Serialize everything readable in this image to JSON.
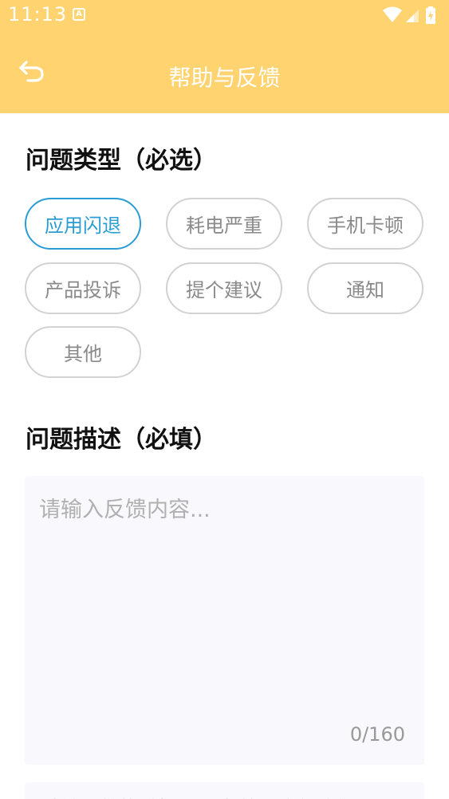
{
  "status_bar": {
    "time": "11:13",
    "notification_glyph": "A",
    "icons": [
      "wifi-icon",
      "cell-signal-icon",
      "battery-icon"
    ]
  },
  "app_bar": {
    "title": "帮助与反馈",
    "back_icon": "back-arrow-icon",
    "background": "#ffd36f"
  },
  "problem_type": {
    "title": "问题类型（必选）",
    "options": [
      {
        "label": "应用闪退",
        "selected": true
      },
      {
        "label": "耗电严重",
        "selected": false
      },
      {
        "label": "手机卡顿",
        "selected": false
      },
      {
        "label": "产品投诉",
        "selected": false
      },
      {
        "label": "提个建议",
        "selected": false
      },
      {
        "label": "通知",
        "selected": false
      },
      {
        "label": "其他",
        "selected": false
      }
    ],
    "accent": "#2a9dd3"
  },
  "description": {
    "title": "问题描述（必填）",
    "placeholder": "请输入反馈内容...",
    "value": "",
    "count": "0/160"
  },
  "contact": {
    "placeholder": "请输入您的手机号码/邮箱，方便我们联系"
  }
}
